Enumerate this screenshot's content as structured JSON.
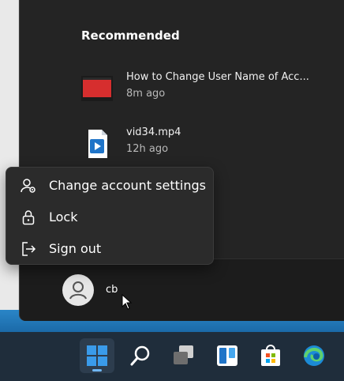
{
  "start_menu": {
    "recommended_title": "Recommended",
    "recommended": [
      {
        "name": "How to Change User Name of Acc...",
        "time": "8m ago",
        "icon": "video-thumbnail-icon"
      },
      {
        "name": "vid34.mp4",
        "time": "12h ago",
        "icon": "video-file-icon"
      }
    ],
    "user": {
      "name": "cb",
      "icon": "user-avatar-icon"
    }
  },
  "account_menu": {
    "items": [
      {
        "label": "Change account settings",
        "icon": "account-settings-icon"
      },
      {
        "label": "Lock",
        "icon": "lock-icon"
      },
      {
        "label": "Sign out",
        "icon": "sign-out-icon"
      }
    ]
  },
  "taskbar": {
    "items": [
      "start-icon",
      "search-icon",
      "task-view-icon",
      "widgets-icon",
      "microsoft-store-icon",
      "edge-icon"
    ]
  },
  "colors": {
    "menu_bg": "#242424",
    "context_bg": "#2b2b2b",
    "taskbar_bg": "#1f2d3b",
    "accent": "#3a9bea"
  }
}
